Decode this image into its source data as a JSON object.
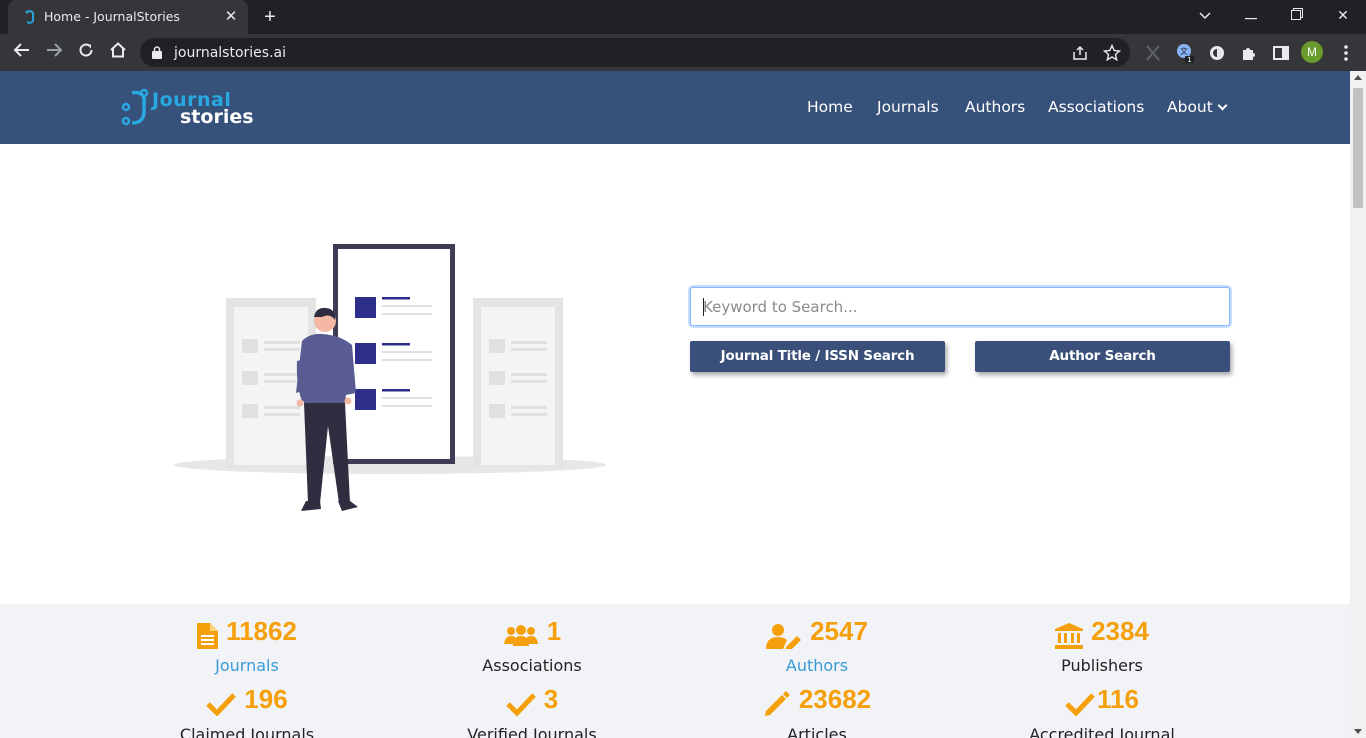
{
  "browser": {
    "tab_title": "Home - JournalStories",
    "url": "journalstories.ai",
    "avatar_letter": "M",
    "extension_badge": "1"
  },
  "nav": {
    "home": "Home",
    "journals": "Journals",
    "authors": "Authors",
    "associations": "Associations",
    "about": "About"
  },
  "search": {
    "placeholder": "Keyword to Search...",
    "journal_button": "Journal Title / ISSN Search",
    "author_button": "Author Search"
  },
  "stats": [
    {
      "value": "11862",
      "label": "Journals",
      "icon": "document-icon"
    },
    {
      "value": "1",
      "label": "Associations",
      "icon": "users-icon"
    },
    {
      "value": "2547",
      "label": "Authors",
      "icon": "user-edit-icon"
    },
    {
      "value": "2384",
      "label": "Publishers",
      "icon": "institution-icon"
    }
  ],
  "stats2": [
    {
      "value": "196",
      "label": "Claimed Journals",
      "icon": "check-icon"
    },
    {
      "value": "3",
      "label": "Verified Journals",
      "icon": "check-icon"
    },
    {
      "value": "23682",
      "label": "Articles",
      "icon": "pencil-icon"
    },
    {
      "value": "116",
      "label": "Accredited Journal",
      "icon": "check-icon"
    }
  ],
  "colors": {
    "header": "#36517a",
    "accent": "#f5a00b",
    "link": "#3a9bd6",
    "button": "#3a507a"
  }
}
